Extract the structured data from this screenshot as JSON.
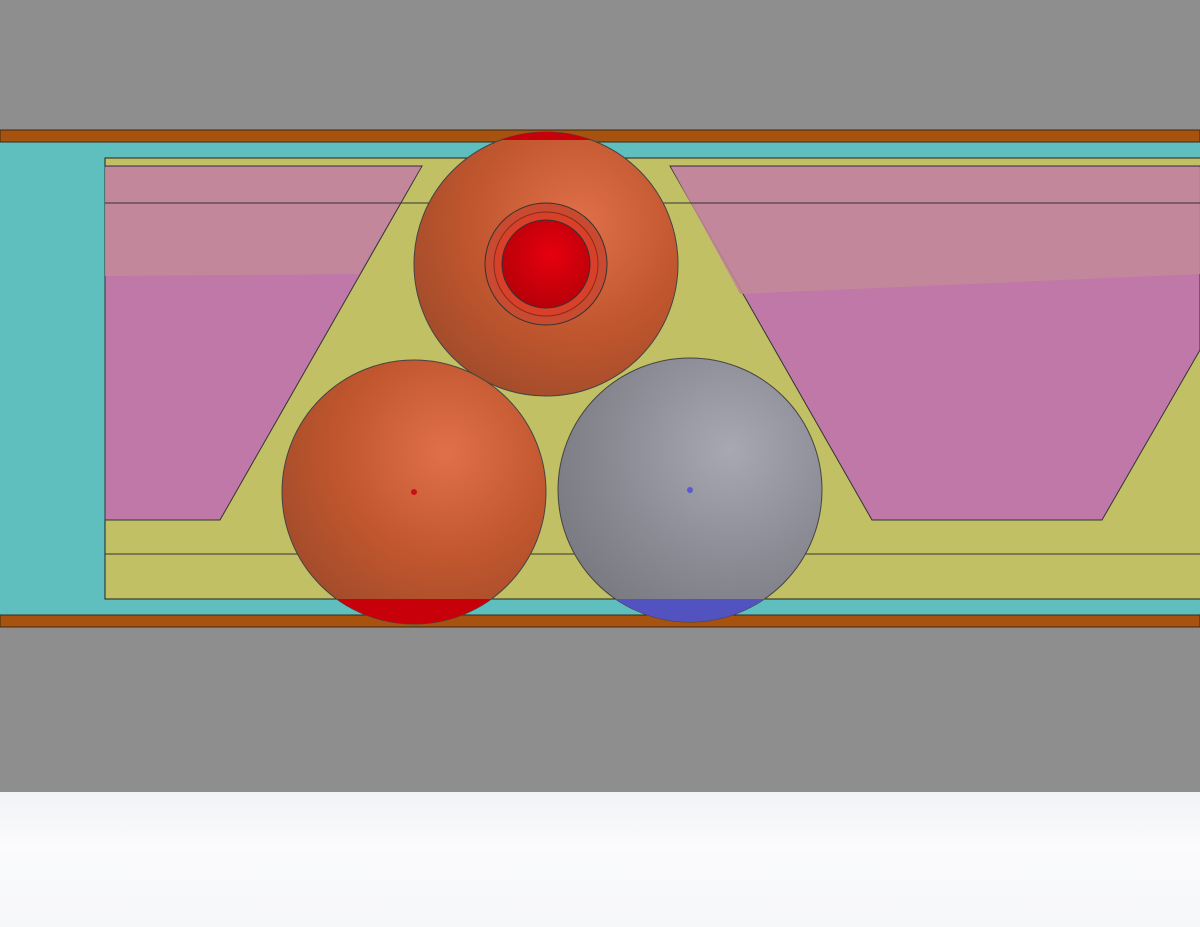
{
  "scene": {
    "title": "",
    "colors": {
      "background": "#8e8e8e",
      "frame_rail": "#a8520f",
      "channel": "#5fbfbf",
      "carrier": "#c2c064",
      "pocket": "#c078a8",
      "pocket_highlight": "#c28a98",
      "ball_orange": "#c0562e",
      "ball_red": "#c8000a",
      "ball_gray": "#8c8c96",
      "ball_blue": "#5252c0",
      "status_area": "#f6f7f9"
    },
    "parts": [
      {
        "name": "top-ball",
        "material": "orange",
        "has_socket": true
      },
      {
        "name": "bottom-left-ball",
        "material": "orange",
        "has_socket": false
      },
      {
        "name": "bottom-right-ball",
        "material": "gray",
        "has_socket": false
      }
    ]
  }
}
